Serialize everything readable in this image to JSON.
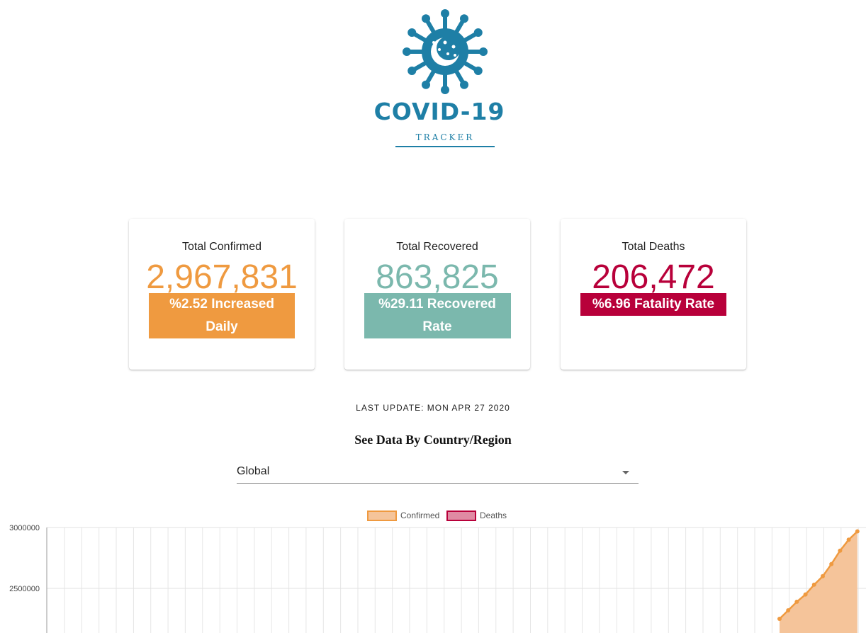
{
  "logo": {
    "title": "COVID-19",
    "subtitle": "TRACKER",
    "brand_color": "#1e7fa6"
  },
  "cards": {
    "confirmed": {
      "title": "Total Confirmed",
      "value": "2,967,831",
      "badge": "%2.52 Increased Daily",
      "color": "#ef9a40"
    },
    "recovered": {
      "title": "Total Recovered",
      "value": "863,825",
      "badge": "%29.11 Recovered Rate",
      "color": "#7bb8ad"
    },
    "deaths": {
      "title": "Total Deaths",
      "value": "206,472",
      "badge": "%6.96 Fatality Rate",
      "color": "#b8003a"
    }
  },
  "last_update": "LAST UPDATE: MON APR 27 2020",
  "section_title": "See Data By Country/Region",
  "region_select": {
    "value": "Global",
    "icon": "dropdown-arrow-icon"
  },
  "chart_data": {
    "type": "area",
    "legend": [
      {
        "label": "Confirmed",
        "color": "#ef9a40"
      },
      {
        "label": "Deaths",
        "color": "#b8003a"
      }
    ],
    "y_ticks": [
      "3000000",
      "2500000"
    ],
    "ylim_visible": [
      2100000,
      3000000
    ],
    "series": [
      {
        "name": "Confirmed",
        "values": [
          2250000,
          2320000,
          2390000,
          2450000,
          2530000,
          2600000,
          2700000,
          2810000,
          2900000,
          2967831
        ]
      },
      {
        "name": "Deaths",
        "values": []
      }
    ],
    "grid": true
  }
}
